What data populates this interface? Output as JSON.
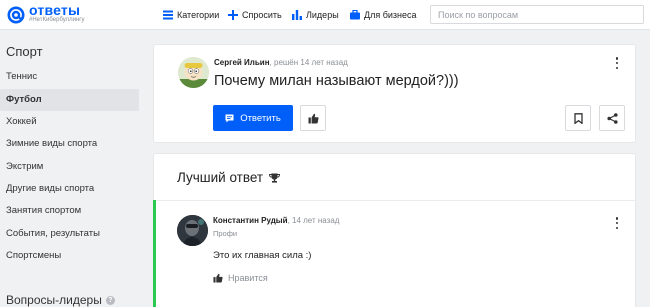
{
  "header": {
    "logo": {
      "name": "ответы",
      "tagline": "#НетКибербуллингу"
    },
    "nav": [
      {
        "label": "Категории",
        "icon": "categories-icon"
      },
      {
        "label": "Спросить",
        "icon": "plus-icon"
      },
      {
        "label": "Лидеры",
        "icon": "leaders-chart-icon"
      },
      {
        "label": "Для бизнеса",
        "icon": "briefcase-icon"
      }
    ],
    "search": {
      "placeholder": "Поиск по вопросам",
      "value": ""
    }
  },
  "sidebar": {
    "title": "Спорт",
    "items": [
      {
        "label": "Теннис"
      },
      {
        "label": "Футбол",
        "active": true
      },
      {
        "label": "Хоккей"
      },
      {
        "label": "Зимние виды спорта"
      },
      {
        "label": "Экстрим"
      },
      {
        "label": "Другие виды спорта"
      },
      {
        "label": "Занятия спортом"
      },
      {
        "label": "События, результаты"
      },
      {
        "label": "Спортсмены"
      }
    ],
    "leaders_title": "Вопросы-лидеры"
  },
  "question": {
    "author": "Сергей Ильин",
    "meta": ", решён 14 лет назад",
    "title": "Почему милан называют мердой?)))",
    "answer_button": "Ответить"
  },
  "best_answer": {
    "heading": "Лучший ответ",
    "author": "Константин Рудый",
    "meta": ", 14 лет назад",
    "role": "Профи",
    "text": "Это их главная сила :)",
    "like_label": "Нравится"
  },
  "colors": {
    "brand": "#005ff9",
    "best_answer_accent": "#2cc850",
    "background": "#f0f1f3"
  }
}
